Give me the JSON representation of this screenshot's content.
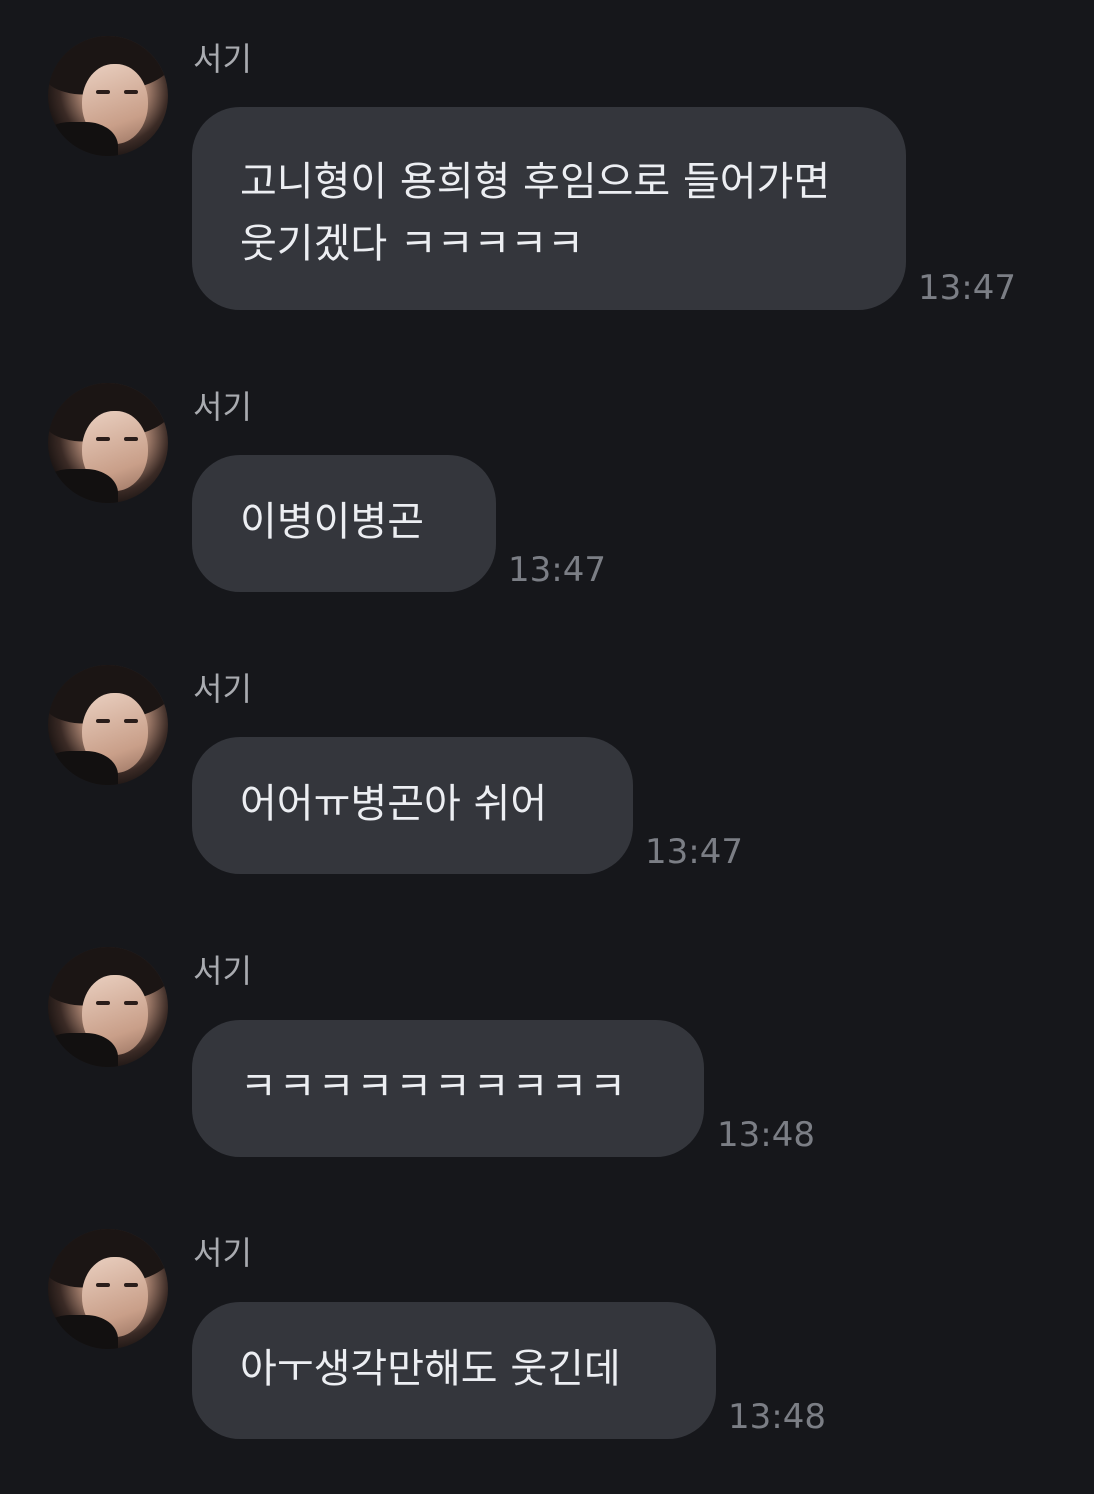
{
  "colors": {
    "background": "#16171b",
    "bubble": "#34363c",
    "message_text": "#eceef2",
    "sender_text": "#a9abb0",
    "timestamp_text": "#7b7e85"
  },
  "messages": [
    {
      "sender": "서기",
      "text": "고니형이 용희형 후임으로 들어가면 웃기겠다 ㅋㅋㅋㅋㅋ",
      "time": "13:47"
    },
    {
      "sender": "서기",
      "text": "이병이병곤",
      "time": "13:47"
    },
    {
      "sender": "서기",
      "text": "어어ㅠ병곤아 쉬어",
      "time": "13:47"
    },
    {
      "sender": "서기",
      "text": "ㅋㅋㅋㅋㅋㅋㅋㅋㅋㅋ",
      "time": "13:48"
    },
    {
      "sender": "서기",
      "text": "아ㅜ생각만해도 웃긴데",
      "time": "13:48"
    }
  ]
}
